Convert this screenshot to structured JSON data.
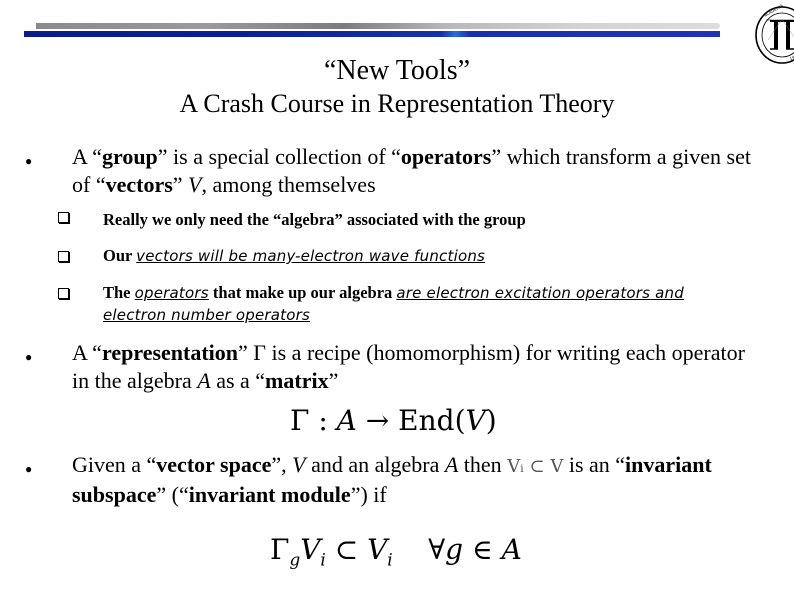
{
  "header": {
    "logo": "university-seal-logo"
  },
  "title": {
    "line1": "“New Tools”",
    "line2": "A Crash Course in Representation Theory"
  },
  "bullets": [
    {
      "parts": [
        {
          "t": "A “"
        },
        {
          "t": "group",
          "b": true
        },
        {
          "t": "” is a special collection of “"
        },
        {
          "t": "operators",
          "b": true
        },
        {
          "t": "” which transform a given set of “"
        },
        {
          "t": "vectors",
          "b": true
        },
        {
          "t": "” "
        },
        {
          "t": "V",
          "i": true
        },
        {
          "t": ", among themselves"
        }
      ],
      "sub_items": [
        {
          "parts": [
            {
              "t": "Really we only need the “"
            },
            {
              "t": "algebra",
              "nb": true
            },
            {
              "t": "” associated with the group"
            }
          ]
        },
        {
          "parts": [
            {
              "t": "Our "
            },
            {
              "t": "vectors will be many-electron wave functions",
              "u": true
            }
          ]
        },
        {
          "parts": [
            {
              "t": "The "
            },
            {
              "t": "operators",
              "u": true
            },
            {
              "t": " that make up our algebra "
            },
            {
              "t": "are electron excitation operators and electron number operators",
              "u": true
            }
          ]
        }
      ]
    },
    {
      "parts": [
        {
          "t": "A “"
        },
        {
          "t": "representation",
          "b": true
        },
        {
          "t": "” Γ is a recipe (homomorphism) for writing each operator in the algebra "
        },
        {
          "t": "A",
          "i": true
        },
        {
          "t": " as a “"
        },
        {
          "t": "matrix",
          "b": true
        },
        {
          "t": "”"
        }
      ],
      "formula": "Γ : A → End(V)"
    },
    {
      "parts": [
        {
          "t": "Given a “"
        },
        {
          "t": "vector space",
          "b": true
        },
        {
          "t": "”, "
        },
        {
          "t": "V",
          "i": true
        },
        {
          "t": " and an algebra "
        },
        {
          "t": "A",
          "i": true
        },
        {
          "t": " then "
        },
        {
          "t": "Vᵢ ⊂ V",
          "m": true
        },
        {
          "t": "  is an “"
        },
        {
          "t": "invariant subspace",
          "b": true
        },
        {
          "t": "” (“"
        },
        {
          "t": "invariant module",
          "b": true
        },
        {
          "t": "”) if"
        }
      ],
      "formula": "Γg Vi ⊂ Vi   ∀g ∈ A"
    }
  ]
}
